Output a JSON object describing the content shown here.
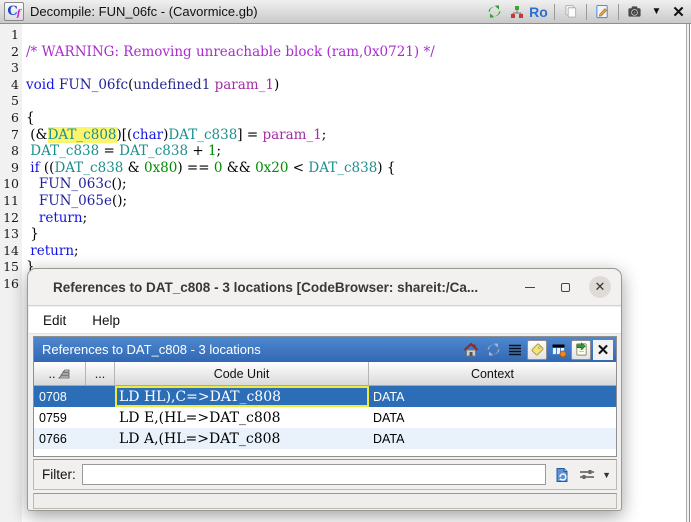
{
  "colors": {
    "keyword": "#1414e6",
    "function_name": "#1f1f9e",
    "type": "#28288f",
    "parameter": "#a62ca6",
    "global_symbol": "#1d8f8f",
    "constant": "#008c00",
    "comment": "#a92ccd",
    "search_highlight": "#fbf56e",
    "selected_row": "#2b6db7",
    "panel_header_blue": "#3d74c2"
  },
  "window": {
    "title": "Decompile: FUN_06fc -  (Cavormice.gb)",
    "icon_label": "Cf",
    "toolbar": {
      "ro_label": "Ro",
      "dropdown_glyph": "▼",
      "close_glyph": "✕"
    }
  },
  "code": {
    "lines": [
      {
        "n": "1",
        "s": []
      },
      {
        "n": "2",
        "s": [
          {
            "t": "/* WARNING: Removing unreachable block (ram,0x0721) */",
            "c": "cm"
          }
        ]
      },
      {
        "n": "3",
        "s": []
      },
      {
        "n": "4",
        "s": [
          {
            "t": "void",
            "c": "kw"
          },
          {
            "t": " ",
            "c": "pl"
          },
          {
            "t": "FUN_06fc",
            "c": "fn"
          },
          {
            "t": "(",
            "c": "pl"
          },
          {
            "t": "undefined1",
            "c": "ty"
          },
          {
            "t": " ",
            "c": "pl"
          },
          {
            "t": "param_1",
            "c": "pa"
          },
          {
            "t": ")",
            "c": "pl"
          }
        ]
      },
      {
        "n": "5",
        "s": []
      },
      {
        "n": "6",
        "s": [
          {
            "t": "{",
            "c": "pl"
          }
        ]
      },
      {
        "n": "7",
        "s": [
          {
            "t": " (&",
            "c": "pl"
          },
          {
            "t": "DAT_c808",
            "c": "hl"
          },
          {
            "t": ")[(",
            "c": "pl"
          },
          {
            "t": "char",
            "c": "kw"
          },
          {
            "t": ")",
            "c": "pl"
          },
          {
            "t": "DAT_c838",
            "c": "gl"
          },
          {
            "t": "] = ",
            "c": "pl"
          },
          {
            "t": "param_1",
            "c": "pa"
          },
          {
            "t": ";",
            "c": "pl"
          }
        ]
      },
      {
        "n": "8",
        "s": [
          {
            "t": " ",
            "c": "pl"
          },
          {
            "t": "DAT_c838",
            "c": "gl"
          },
          {
            "t": " = ",
            "c": "pl"
          },
          {
            "t": "DAT_c838",
            "c": "gl"
          },
          {
            "t": " + ",
            "c": "pl"
          },
          {
            "t": "1",
            "c": "ct"
          },
          {
            "t": ";",
            "c": "pl"
          }
        ]
      },
      {
        "n": "9",
        "s": [
          {
            "t": " ",
            "c": "pl"
          },
          {
            "t": "if",
            "c": "kw"
          },
          {
            "t": " ((",
            "c": "pl"
          },
          {
            "t": "DAT_c838",
            "c": "gl"
          },
          {
            "t": " & ",
            "c": "pl"
          },
          {
            "t": "0x80",
            "c": "ct"
          },
          {
            "t": ") == ",
            "c": "pl"
          },
          {
            "t": "0",
            "c": "ct"
          },
          {
            "t": " && ",
            "c": "pl"
          },
          {
            "t": "0x20",
            "c": "ct"
          },
          {
            "t": " < ",
            "c": "pl"
          },
          {
            "t": "DAT_c838",
            "c": "gl"
          },
          {
            "t": ") {",
            "c": "pl"
          }
        ]
      },
      {
        "n": "10",
        "s": [
          {
            "t": "   ",
            "c": "pl"
          },
          {
            "t": "FUN_063c",
            "c": "fn"
          },
          {
            "t": "();",
            "c": "pl"
          }
        ]
      },
      {
        "n": "11",
        "s": [
          {
            "t": "   ",
            "c": "pl"
          },
          {
            "t": "FUN_065e",
            "c": "fn"
          },
          {
            "t": "();",
            "c": "pl"
          }
        ]
      },
      {
        "n": "12",
        "s": [
          {
            "t": "   ",
            "c": "pl"
          },
          {
            "t": "return",
            "c": "kw"
          },
          {
            "t": ";",
            "c": "pl"
          }
        ]
      },
      {
        "n": "13",
        "s": [
          {
            "t": " }",
            "c": "pl"
          }
        ]
      },
      {
        "n": "14",
        "s": [
          {
            "t": " ",
            "c": "pl"
          },
          {
            "t": "return",
            "c": "kw"
          },
          {
            "t": ";",
            "c": "pl"
          }
        ]
      },
      {
        "n": "15",
        "s": [
          {
            "t": "}",
            "c": "pl"
          }
        ]
      },
      {
        "n": "16",
        "s": []
      }
    ]
  },
  "dialog": {
    "title": "References to DAT_c808 - 3 locations [CodeBrowser: shareit:/Ca...",
    "menu": [
      "Edit",
      "Help"
    ],
    "panel_title": "References to DAT_c808 - 3 locations",
    "table": {
      "columns": [
        "..",
        "...",
        "Code Unit",
        "Context"
      ],
      "rows": [
        {
          "address": "0708",
          "code_unit": "LD HL),C=>DAT_c808",
          "context": "DATA",
          "selected": true
        },
        {
          "address": "0759",
          "code_unit": "LD E,(HL=>DAT_c808",
          "context": "DATA",
          "selected": false
        },
        {
          "address": "0766",
          "code_unit": "LD A,(HL=>DAT_c808",
          "context": "DATA",
          "selected": false
        }
      ]
    },
    "filter": {
      "label": "Filter:",
      "value": "",
      "placeholder": ""
    }
  }
}
